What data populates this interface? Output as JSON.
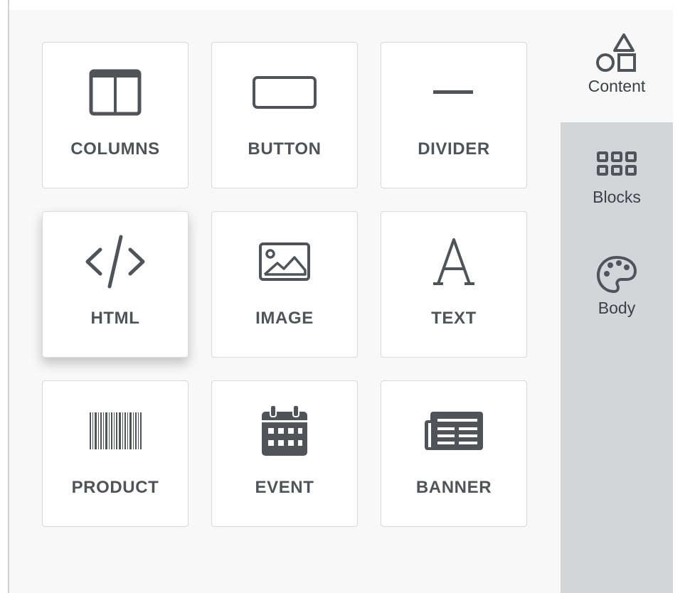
{
  "tools": [
    {
      "label": "COLUMNS",
      "icon": "columns-icon"
    },
    {
      "label": "BUTTON",
      "icon": "button-icon"
    },
    {
      "label": "DIVIDER",
      "icon": "divider-icon"
    },
    {
      "label": "HTML",
      "icon": "code-icon"
    },
    {
      "label": "IMAGE",
      "icon": "image-icon"
    },
    {
      "label": "TEXT",
      "icon": "text-icon"
    },
    {
      "label": "PRODUCT",
      "icon": "barcode-icon"
    },
    {
      "label": "EVENT",
      "icon": "calendar-icon"
    },
    {
      "label": "BANNER",
      "icon": "newspaper-icon"
    }
  ],
  "tabs": [
    {
      "label": "Content",
      "icon": "shapes-icon",
      "active": true
    },
    {
      "label": "Blocks",
      "icon": "grid-icon",
      "active": false
    },
    {
      "label": "Body",
      "icon": "palette-icon",
      "active": false
    }
  ],
  "colors": {
    "icon": "#505459",
    "panel_bg": "#f8f8f8",
    "rail_bg": "#d3d6d9",
    "tile_border": "#d9d9d9"
  }
}
